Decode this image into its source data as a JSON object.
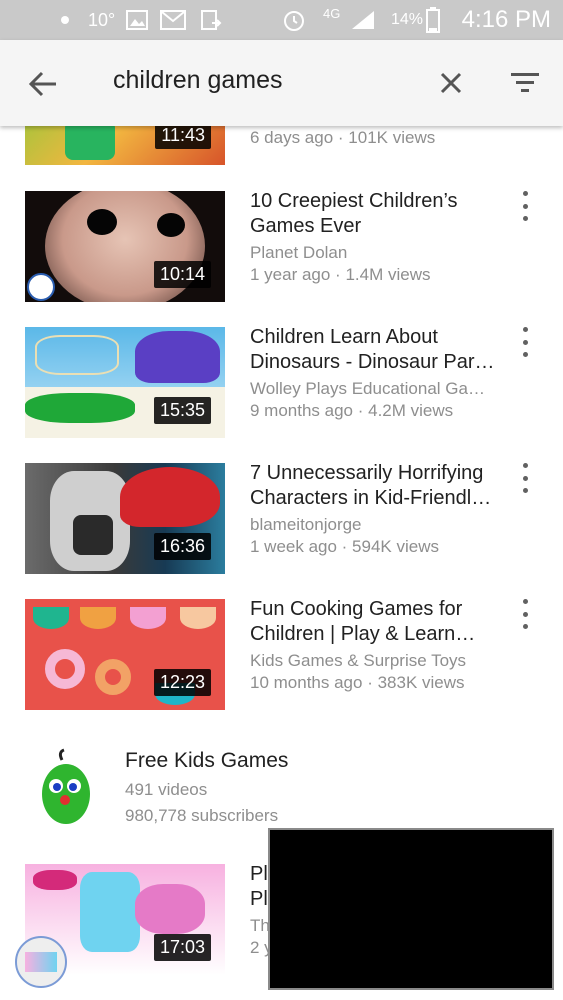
{
  "status_bar": {
    "temperature": "10°",
    "network": "4G",
    "battery": "14%",
    "time": "4:16 PM"
  },
  "search": {
    "query": "children games"
  },
  "top_partial": {
    "duration": "11:43",
    "meta": "6 days ago · 101K views"
  },
  "videos": [
    {
      "title_line1": "10 Creepiest Children’s",
      "title_line2": "Games Ever",
      "channel": "Planet Dolan",
      "meta": "1 year ago · 1.4M views",
      "duration": "10:14"
    },
    {
      "title_line1": "Children Learn About",
      "title_line2": "Dinosaurs - Dinosaur Par…",
      "channel": "Wolley Plays Educational Ga…",
      "meta": "9 months ago · 4.2M views",
      "duration": "15:35"
    },
    {
      "title_line1": "7 Unnecessarily Horrifying",
      "title_line2": "Characters in Kid-Friendl…",
      "channel": "blameitonjorge",
      "meta": "1 week ago · 594K views",
      "duration": "16:36"
    },
    {
      "title_line1": "Fun Cooking Games for",
      "title_line2": "Children | Play & Learn…",
      "channel": "Kids Games & Surprise Toys",
      "meta": "10 months ago · 383K views",
      "duration": "12:23"
    }
  ],
  "channel": {
    "name": "Free Kids Games",
    "videos": "491 videos",
    "subscribers": "980,778 subscribers"
  },
  "bottom_partial": {
    "duration": "17:03",
    "title_line1": "Pl",
    "title_line2": "Pl",
    "channel": "Th",
    "meta": "2 y"
  }
}
